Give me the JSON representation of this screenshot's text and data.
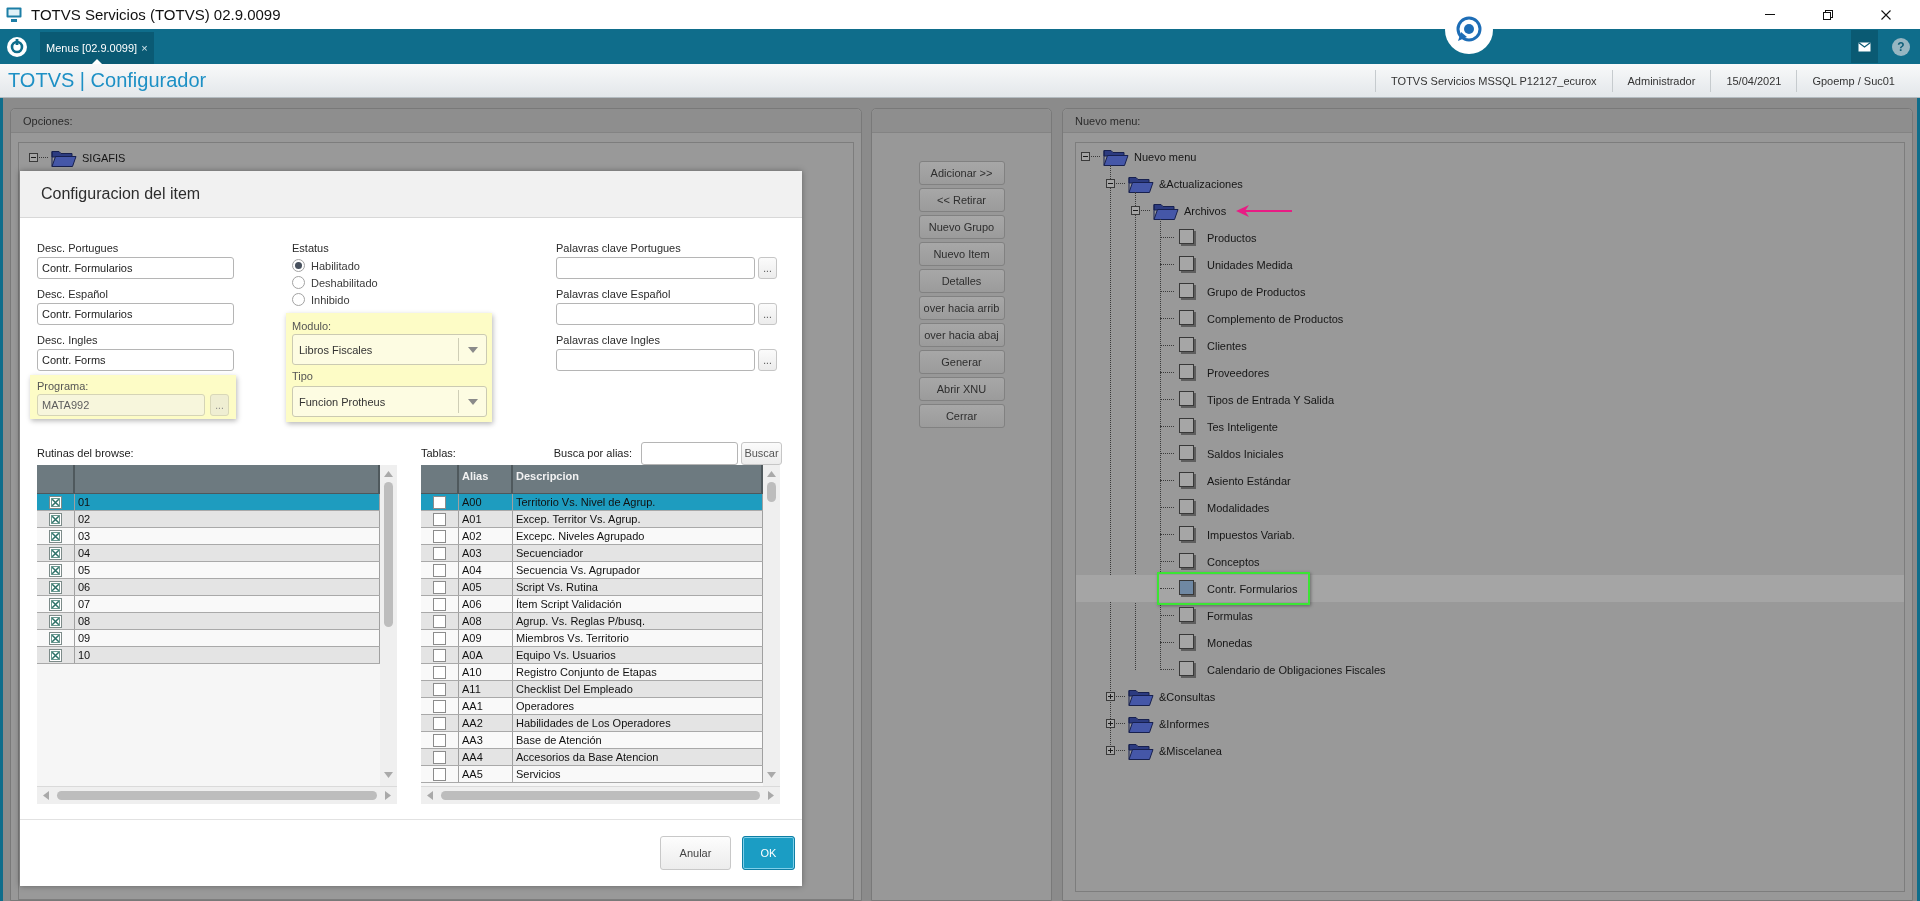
{
  "window": {
    "title": "TOTVS Servicios (TOTVS) 02.9.0099"
  },
  "tab_bar": {
    "tabs": [
      {
        "label": "Menus [02.9.0099]",
        "close": "×",
        "selected": true
      }
    ],
    "help": "?"
  },
  "header": {
    "app_title": "TOTVS | Configurador",
    "info": [
      "TOTVS Servicios MSSQL P12127_ecurox",
      "Administrador",
      "15/04/2021",
      "Gpoemp / Suc01"
    ]
  },
  "options_panel": {
    "title": "Opciones:",
    "tree": [
      {
        "label": "SIGAFIS",
        "kind": "folder",
        "expanded": true,
        "selected": false
      }
    ]
  },
  "actions_panel": {
    "buttons": [
      "Adicionar >>",
      "<< Retirar",
      "Nuevo Grupo",
      "Nuevo Item",
      "Detalles",
      "over hacia arrib",
      "over hacia abaj",
      "Generar",
      "Abrir XNU",
      "Cerrar"
    ]
  },
  "menu_panel": {
    "title": "Nuevo menu:",
    "tree": [
      {
        "label": "Nuevo menu",
        "kind": "folder",
        "expanded": true,
        "selected": false,
        "children": [
          {
            "label": "&Actualizaciones",
            "kind": "folder",
            "expanded": true,
            "selected": false,
            "children": [
              {
                "label": "Archivos",
                "kind": "folder",
                "expanded": true,
                "selected": false,
                "arrow_marker": true,
                "children": [
                  {
                    "label": "Productos",
                    "kind": "item",
                    "selected": false
                  },
                  {
                    "label": "Unidades Medida",
                    "kind": "item",
                    "selected": false
                  },
                  {
                    "label": "Grupo de Productos",
                    "kind": "item",
                    "selected": false
                  },
                  {
                    "label": "Complemento de Productos",
                    "kind": "item",
                    "selected": false
                  },
                  {
                    "label": "Clientes",
                    "kind": "item",
                    "selected": false
                  },
                  {
                    "label": "Proveedores",
                    "kind": "item",
                    "selected": false
                  },
                  {
                    "label": "Tipos de Entrada Y Salida",
                    "kind": "item",
                    "selected": false
                  },
                  {
                    "label": "Tes Inteligente",
                    "kind": "item",
                    "selected": false
                  },
                  {
                    "label": "Saldos Iniciales",
                    "kind": "item",
                    "selected": false
                  },
                  {
                    "label": "Asiento Estándar",
                    "kind": "item",
                    "selected": false
                  },
                  {
                    "label": "Modalidades",
                    "kind": "item",
                    "selected": false
                  },
                  {
                    "label": "Impuestos Variab.",
                    "kind": "item",
                    "selected": false
                  },
                  {
                    "label": "Conceptos",
                    "kind": "item",
                    "selected": false
                  },
                  {
                    "label": "Contr. Formularios",
                    "kind": "item",
                    "selected": true,
                    "highlight_frame": true
                  },
                  {
                    "label": "Formulas",
                    "kind": "item",
                    "selected": false
                  },
                  {
                    "label": "Monedas",
                    "kind": "item",
                    "selected": false
                  },
                  {
                    "label": "Calendario de Obligaciones Fiscales",
                    "kind": "item",
                    "selected": false
                  }
                ]
              }
            ]
          },
          {
            "label": "&Consultas",
            "kind": "folder",
            "expanded": false,
            "selected": false
          },
          {
            "label": "&Informes",
            "kind": "folder",
            "expanded": false,
            "selected": false
          },
          {
            "label": "&Miscelanea",
            "kind": "folder",
            "expanded": false,
            "selected": false
          }
        ]
      }
    ]
  },
  "dialog": {
    "title": "Configuracion del item",
    "descriptions": [
      {
        "label": "Desc. Portugues",
        "value": "Contr. Formularios"
      },
      {
        "label": "Desc. Español",
        "value": "Contr. Formularios"
      },
      {
        "label": "Desc. Ingles",
        "value": "Contr. Forms"
      }
    ],
    "program": {
      "label": "Programa:",
      "value": "MATA992",
      "button": "...",
      "disabled": true,
      "highlighted": true
    },
    "status": {
      "label": "Estatus",
      "options": [
        {
          "label": "Habilitado",
          "selected": true
        },
        {
          "label": "Deshabilitado",
          "selected": false
        },
        {
          "label": "Inhibido",
          "selected": false
        }
      ]
    },
    "classification": {
      "highlighted": true,
      "selects": [
        {
          "label": "Modulo:",
          "value": "Libros Fiscales"
        },
        {
          "label": "Tipo",
          "value": "Funcion Protheus"
        }
      ]
    },
    "keywords": [
      {
        "label": "Palavras clave Portugues",
        "button": "..."
      },
      {
        "label": "Palavras clave Español",
        "button": "..."
      },
      {
        "label": "Palavras clave Ingles",
        "button": "..."
      }
    ],
    "browse_routines": {
      "label": "Rutinas del browse:",
      "rows": [
        {
          "code": "01",
          "checked": true,
          "selected": true
        },
        {
          "code": "02",
          "checked": true,
          "selected": false
        },
        {
          "code": "03",
          "checked": true,
          "selected": false
        },
        {
          "code": "04",
          "checked": true,
          "selected": false
        },
        {
          "code": "05",
          "checked": true,
          "selected": false
        },
        {
          "code": "06",
          "checked": true,
          "selected": false
        },
        {
          "code": "07",
          "checked": true,
          "selected": false
        },
        {
          "code": "08",
          "checked": true,
          "selected": false
        },
        {
          "code": "09",
          "checked": true,
          "selected": false
        },
        {
          "code": "10",
          "checked": true,
          "selected": false
        }
      ]
    },
    "tables": {
      "label": "Tablas:",
      "search_label": "Busca por alias:",
      "search_button": "Buscar",
      "columns": [
        "Alias",
        "Descripcion"
      ],
      "rows": [
        {
          "alias": "A00",
          "description": "Territorio Vs. Nivel de Agrup.",
          "checked": false,
          "selected": true
        },
        {
          "alias": "A01",
          "description": "Excep. Territor Vs. Agrup.",
          "checked": false,
          "selected": false
        },
        {
          "alias": "A02",
          "description": "Excepc. Niveles Agrupado",
          "checked": false,
          "selected": false
        },
        {
          "alias": "A03",
          "description": "Secuenciador",
          "checked": false,
          "selected": false
        },
        {
          "alias": "A04",
          "description": "Secuencia Vs. Agrupador",
          "checked": false,
          "selected": false
        },
        {
          "alias": "A05",
          "description": "Script Vs. Rutina",
          "checked": false,
          "selected": false
        },
        {
          "alias": "A06",
          "description": "Ítem Script Validación",
          "checked": false,
          "selected": false
        },
        {
          "alias": "A08",
          "description": "Agrup. Vs. Reglas P/busq.",
          "checked": false,
          "selected": false
        },
        {
          "alias": "A09",
          "description": "Miembros Vs. Territorio",
          "checked": false,
          "selected": false
        },
        {
          "alias": "A0A",
          "description": "Equipo Vs. Usuarios",
          "checked": false,
          "selected": false
        },
        {
          "alias": "A10",
          "description": "Registro Conjunto de Etapas",
          "checked": false,
          "selected": false
        },
        {
          "alias": "A11",
          "description": "Checklist Del Empleado",
          "checked": false,
          "selected": false
        },
        {
          "alias": "AA1",
          "description": "Operadores",
          "checked": false,
          "selected": false
        },
        {
          "alias": "AA2",
          "description": "Habilidades de Los Operadores",
          "checked": false,
          "selected": false
        },
        {
          "alias": "AA3",
          "description": "Base de Atención",
          "checked": false,
          "selected": false
        },
        {
          "alias": "AA4",
          "description": "Accesorios da Base Atencion",
          "checked": false,
          "selected": false
        },
        {
          "alias": "AA5",
          "description": "Servicios",
          "checked": false,
          "selected": false
        }
      ]
    },
    "buttons": [
      {
        "label": "Anular",
        "kind": "secondary"
      },
      {
        "label": "OK",
        "kind": "primary"
      }
    ]
  }
}
